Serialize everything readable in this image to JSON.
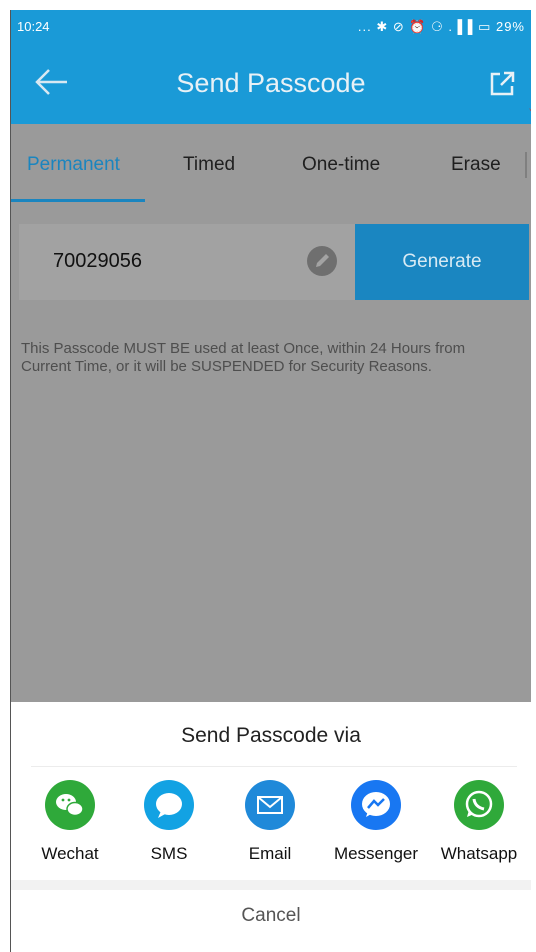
{
  "status_bar": {
    "time": "10:24",
    "indicators": "... ✱ ⊘ ⏰ ⚆ .▐▐ ▭ 29%"
  },
  "app_bar": {
    "title": "Send Passcode",
    "back_icon": "back-arrow-icon",
    "share_icon": "external-share-icon",
    "color": "#1a9ad7"
  },
  "tabs": [
    {
      "label": "Permanent",
      "active": true
    },
    {
      "label": "Timed",
      "active": false
    },
    {
      "label": "One-time",
      "active": false
    },
    {
      "label": "Erase",
      "active": false
    }
  ],
  "passcode": {
    "value": "70029056",
    "edit_icon": "pencil-icon",
    "generate_label": "Generate"
  },
  "notice": "This Passcode MUST BE used at least Once, within 24 Hours from Current Time, or it will be SUSPENDED for Security Reasons.",
  "share_sheet": {
    "title": "Send Passcode via",
    "options": [
      {
        "label": "Wechat",
        "icon": "wechat-icon",
        "color": "#2fa93a"
      },
      {
        "label": "SMS",
        "icon": "sms-icon",
        "color": "#12a2e3"
      },
      {
        "label": "Email",
        "icon": "email-icon",
        "color": "#1f89d9"
      },
      {
        "label": "Messenger",
        "icon": "messenger-icon",
        "color": "#1877f2"
      },
      {
        "label": "Whatsapp",
        "icon": "whatsapp-icon",
        "color": "#2fa93a"
      }
    ],
    "cancel_label": "Cancel"
  }
}
